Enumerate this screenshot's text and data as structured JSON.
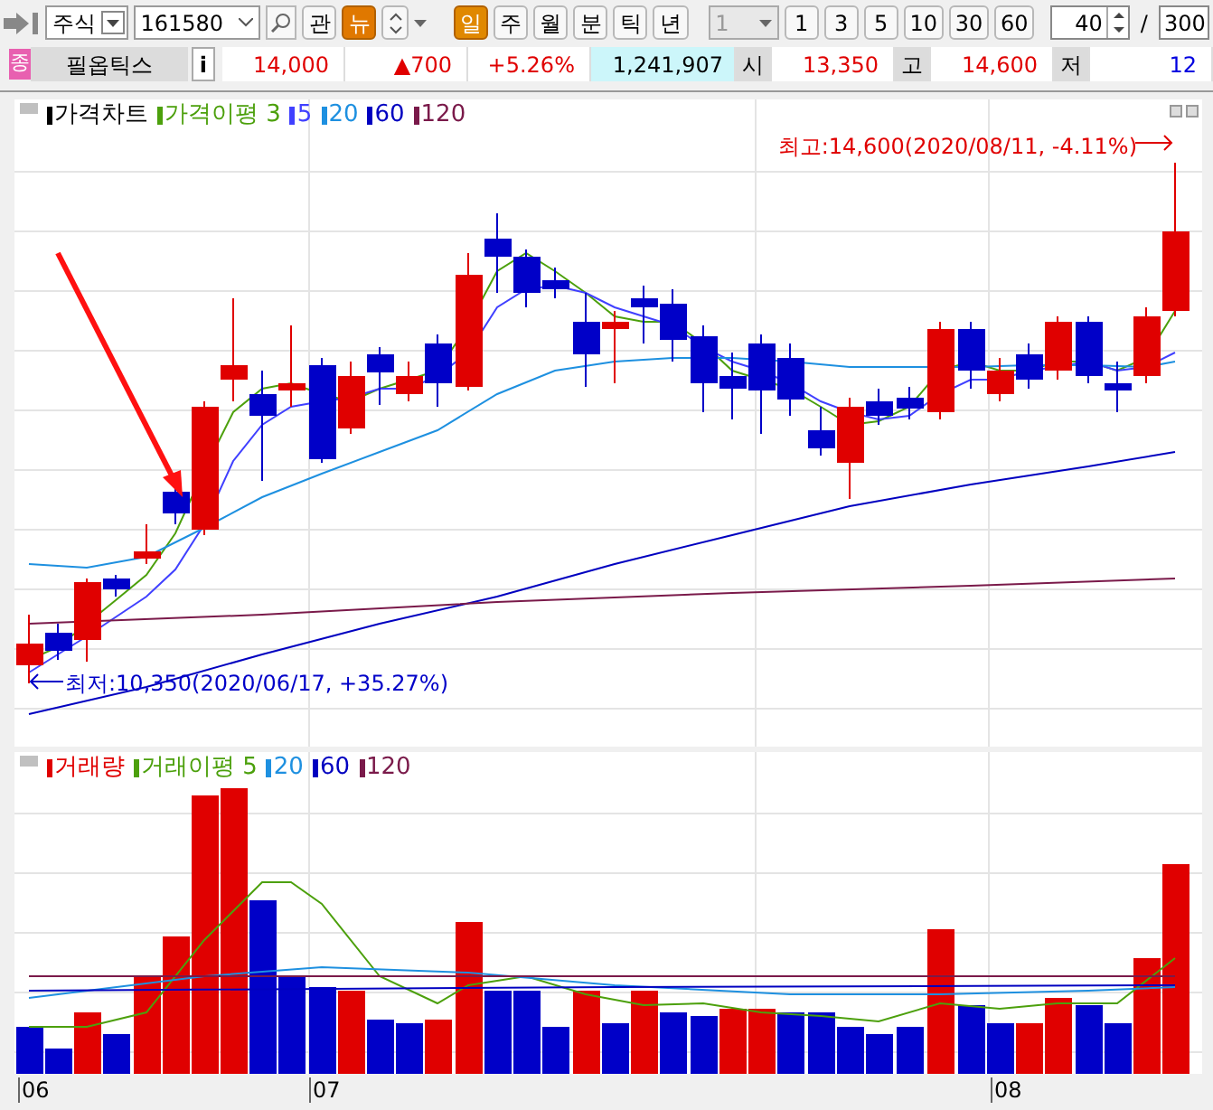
{
  "toolbar": {
    "market_select": {
      "value": "주식"
    },
    "code_field": {
      "value": "161580"
    },
    "buttons": [
      {
        "label": "관",
        "selected": false
      },
      {
        "label": "뉴",
        "selected": true
      }
    ],
    "period_tabs": [
      {
        "label": "일",
        "selected": true
      },
      {
        "label": "주",
        "selected": false
      },
      {
        "label": "월",
        "selected": false
      },
      {
        "label": "분",
        "selected": false
      },
      {
        "label": "틱",
        "selected": false
      },
      {
        "label": "년",
        "selected": false
      }
    ],
    "interval_select": {
      "value": "1",
      "disabled": true
    },
    "interval_buttons": [
      "1",
      "3",
      "5",
      "10",
      "30",
      "60"
    ],
    "count_field": {
      "value": "40"
    },
    "separator": "/",
    "total_field": {
      "value": "300"
    }
  },
  "quote_bar": {
    "badge": "종",
    "name": "필옵틱스",
    "info": "i",
    "cells": [
      {
        "kind": "value",
        "text": "14,000",
        "color": "#e00000"
      },
      {
        "kind": "value",
        "text": "▲700",
        "color": "#e00000"
      },
      {
        "kind": "value",
        "text": "+5.26%",
        "color": "#e00000"
      },
      {
        "kind": "volume",
        "text": "1,241,907",
        "color": "#000000"
      },
      {
        "kind": "label",
        "text": "시",
        "color": "#000000"
      },
      {
        "kind": "value",
        "text": "13,350",
        "color": "#e00000"
      },
      {
        "kind": "label",
        "text": "고",
        "color": "#000000"
      },
      {
        "kind": "value",
        "text": "14,600",
        "color": "#e00000"
      },
      {
        "kind": "label",
        "text": "저",
        "color": "#000000"
      },
      {
        "kind": "value",
        "text": "12",
        "color": "#0000e0"
      }
    ]
  },
  "price_chart": {
    "legend": [
      {
        "label": "가격차트",
        "color": "#000000"
      },
      {
        "label": "가격이평 3",
        "color": "#4ca00c"
      },
      {
        "label": "5",
        "color": "#4040ff"
      },
      {
        "label": "20",
        "color": "#1e90e0"
      },
      {
        "label": "60",
        "color": "#0000c0"
      },
      {
        "label": "120",
        "color": "#7a1a4a"
      }
    ],
    "high_note": "최고:14,600(2020/08/11, -4.11%)",
    "low_note": "최저:10,350(2020/06/17, +35.27%)"
  },
  "volume_chart": {
    "legend": [
      {
        "label": "거래량",
        "color": "#e00000"
      },
      {
        "label": "거래이평 5",
        "color": "#4ca00c"
      },
      {
        "label": "20",
        "color": "#1e90e0"
      },
      {
        "label": "60",
        "color": "#0000c0"
      },
      {
        "label": "120",
        "color": "#7a1a4a"
      }
    ]
  },
  "x_axis": [
    "06",
    "07",
    "08"
  ]
}
